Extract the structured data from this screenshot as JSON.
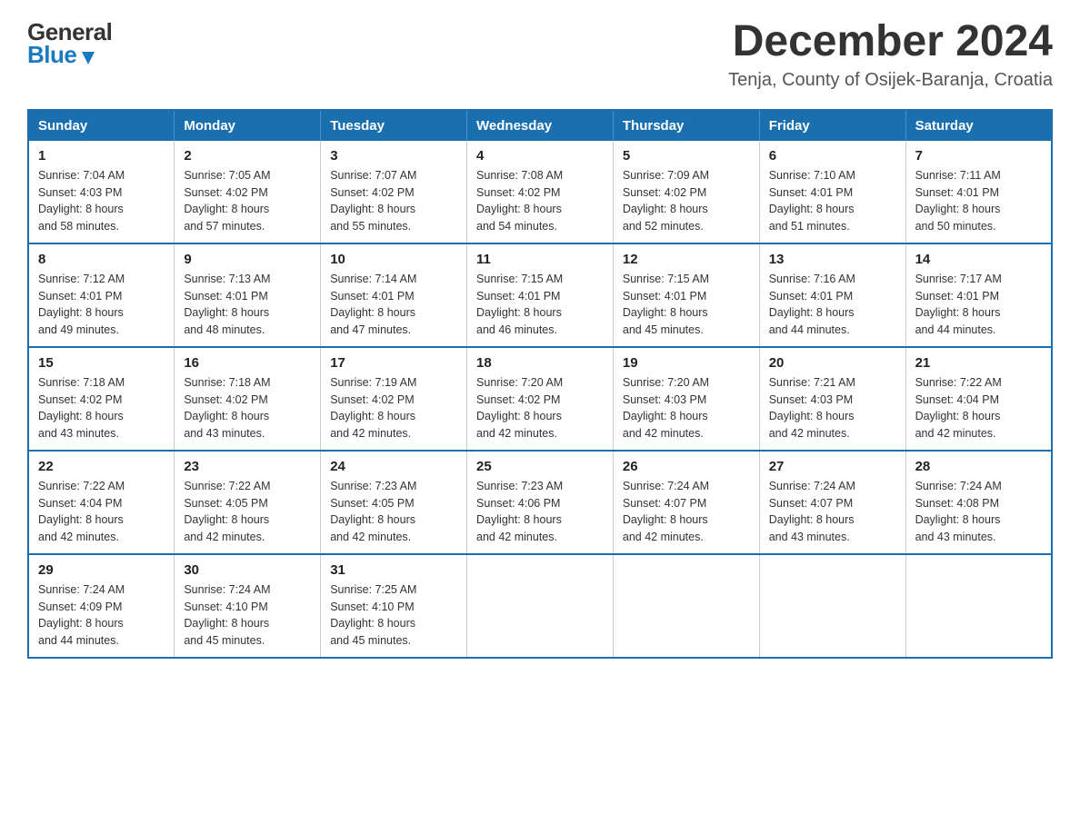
{
  "header": {
    "logo": {
      "general": "General",
      "blue": "Blue",
      "arrow_color": "#1a7abf"
    },
    "title": "December 2024",
    "subtitle": "Tenja, County of Osijek-Baranja, Croatia"
  },
  "calendar": {
    "days_of_week": [
      "Sunday",
      "Monday",
      "Tuesday",
      "Wednesday",
      "Thursday",
      "Friday",
      "Saturday"
    ],
    "weeks": [
      [
        {
          "day": "1",
          "sunrise": "7:04 AM",
          "sunset": "4:03 PM",
          "daylight": "8 hours and 58 minutes."
        },
        {
          "day": "2",
          "sunrise": "7:05 AM",
          "sunset": "4:02 PM",
          "daylight": "8 hours and 57 minutes."
        },
        {
          "day": "3",
          "sunrise": "7:07 AM",
          "sunset": "4:02 PM",
          "daylight": "8 hours and 55 minutes."
        },
        {
          "day": "4",
          "sunrise": "7:08 AM",
          "sunset": "4:02 PM",
          "daylight": "8 hours and 54 minutes."
        },
        {
          "day": "5",
          "sunrise": "7:09 AM",
          "sunset": "4:02 PM",
          "daylight": "8 hours and 52 minutes."
        },
        {
          "day": "6",
          "sunrise": "7:10 AM",
          "sunset": "4:01 PM",
          "daylight": "8 hours and 51 minutes."
        },
        {
          "day": "7",
          "sunrise": "7:11 AM",
          "sunset": "4:01 PM",
          "daylight": "8 hours and 50 minutes."
        }
      ],
      [
        {
          "day": "8",
          "sunrise": "7:12 AM",
          "sunset": "4:01 PM",
          "daylight": "8 hours and 49 minutes."
        },
        {
          "day": "9",
          "sunrise": "7:13 AM",
          "sunset": "4:01 PM",
          "daylight": "8 hours and 48 minutes."
        },
        {
          "day": "10",
          "sunrise": "7:14 AM",
          "sunset": "4:01 PM",
          "daylight": "8 hours and 47 minutes."
        },
        {
          "day": "11",
          "sunrise": "7:15 AM",
          "sunset": "4:01 PM",
          "daylight": "8 hours and 46 minutes."
        },
        {
          "day": "12",
          "sunrise": "7:15 AM",
          "sunset": "4:01 PM",
          "daylight": "8 hours and 45 minutes."
        },
        {
          "day": "13",
          "sunrise": "7:16 AM",
          "sunset": "4:01 PM",
          "daylight": "8 hours and 44 minutes."
        },
        {
          "day": "14",
          "sunrise": "7:17 AM",
          "sunset": "4:01 PM",
          "daylight": "8 hours and 44 minutes."
        }
      ],
      [
        {
          "day": "15",
          "sunrise": "7:18 AM",
          "sunset": "4:02 PM",
          "daylight": "8 hours and 43 minutes."
        },
        {
          "day": "16",
          "sunrise": "7:18 AM",
          "sunset": "4:02 PM",
          "daylight": "8 hours and 43 minutes."
        },
        {
          "day": "17",
          "sunrise": "7:19 AM",
          "sunset": "4:02 PM",
          "daylight": "8 hours and 42 minutes."
        },
        {
          "day": "18",
          "sunrise": "7:20 AM",
          "sunset": "4:02 PM",
          "daylight": "8 hours and 42 minutes."
        },
        {
          "day": "19",
          "sunrise": "7:20 AM",
          "sunset": "4:03 PM",
          "daylight": "8 hours and 42 minutes."
        },
        {
          "day": "20",
          "sunrise": "7:21 AM",
          "sunset": "4:03 PM",
          "daylight": "8 hours and 42 minutes."
        },
        {
          "day": "21",
          "sunrise": "7:22 AM",
          "sunset": "4:04 PM",
          "daylight": "8 hours and 42 minutes."
        }
      ],
      [
        {
          "day": "22",
          "sunrise": "7:22 AM",
          "sunset": "4:04 PM",
          "daylight": "8 hours and 42 minutes."
        },
        {
          "day": "23",
          "sunrise": "7:22 AM",
          "sunset": "4:05 PM",
          "daylight": "8 hours and 42 minutes."
        },
        {
          "day": "24",
          "sunrise": "7:23 AM",
          "sunset": "4:05 PM",
          "daylight": "8 hours and 42 minutes."
        },
        {
          "day": "25",
          "sunrise": "7:23 AM",
          "sunset": "4:06 PM",
          "daylight": "8 hours and 42 minutes."
        },
        {
          "day": "26",
          "sunrise": "7:24 AM",
          "sunset": "4:07 PM",
          "daylight": "8 hours and 42 minutes."
        },
        {
          "day": "27",
          "sunrise": "7:24 AM",
          "sunset": "4:07 PM",
          "daylight": "8 hours and 43 minutes."
        },
        {
          "day": "28",
          "sunrise": "7:24 AM",
          "sunset": "4:08 PM",
          "daylight": "8 hours and 43 minutes."
        }
      ],
      [
        {
          "day": "29",
          "sunrise": "7:24 AM",
          "sunset": "4:09 PM",
          "daylight": "8 hours and 44 minutes."
        },
        {
          "day": "30",
          "sunrise": "7:24 AM",
          "sunset": "4:10 PM",
          "daylight": "8 hours and 45 minutes."
        },
        {
          "day": "31",
          "sunrise": "7:25 AM",
          "sunset": "4:10 PM",
          "daylight": "8 hours and 45 minutes."
        },
        null,
        null,
        null,
        null
      ]
    ],
    "labels": {
      "sunrise": "Sunrise:",
      "sunset": "Sunset:",
      "daylight": "Daylight:"
    }
  }
}
